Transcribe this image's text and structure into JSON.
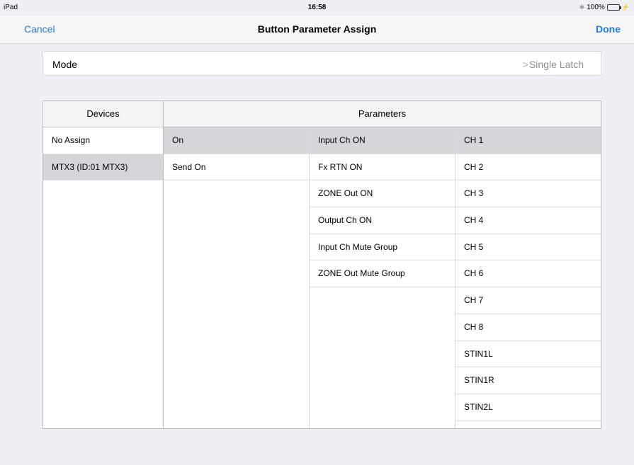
{
  "status_bar": {
    "device": "iPad",
    "time": "16:58",
    "battery": "100%"
  },
  "nav": {
    "cancel_label": "Cancel",
    "title": "Button Parameter Assign",
    "done_label": "Done"
  },
  "mode": {
    "label": "Mode",
    "value": "Single Latch"
  },
  "table": {
    "devices_header": "Devices",
    "parameters_header": "Parameters",
    "devices": [
      {
        "label": "No Assign",
        "selected": false
      },
      {
        "label": "MTX3 (ID:01 MTX3)",
        "selected": true
      }
    ],
    "categories": [
      {
        "label": "On",
        "selected": true
      },
      {
        "label": "Send On",
        "selected": false
      }
    ],
    "parameters": [
      {
        "label": "Input Ch ON",
        "selected": true
      },
      {
        "label": "Fx RTN ON",
        "selected": false
      },
      {
        "label": "ZONE Out ON",
        "selected": false
      },
      {
        "label": "Output Ch ON",
        "selected": false
      },
      {
        "label": "Input Ch Mute Group",
        "selected": false
      },
      {
        "label": "ZONE Out Mute Group",
        "selected": false
      }
    ],
    "channels": [
      {
        "label": "CH 1",
        "selected": true
      },
      {
        "label": "CH 2",
        "selected": false
      },
      {
        "label": "CH 3",
        "selected": false
      },
      {
        "label": "CH 4",
        "selected": false
      },
      {
        "label": "CH 5",
        "selected": false
      },
      {
        "label": "CH 6",
        "selected": false
      },
      {
        "label": "CH 7",
        "selected": false
      },
      {
        "label": "CH 8",
        "selected": false
      },
      {
        "label": "STIN1L",
        "selected": false
      },
      {
        "label": "STIN1R",
        "selected": false
      },
      {
        "label": "STIN2L",
        "selected": false
      }
    ]
  },
  "colors": {
    "accent": "#1a7cf0",
    "selected_row": "#d6d6d8",
    "background": "#efeff4"
  }
}
